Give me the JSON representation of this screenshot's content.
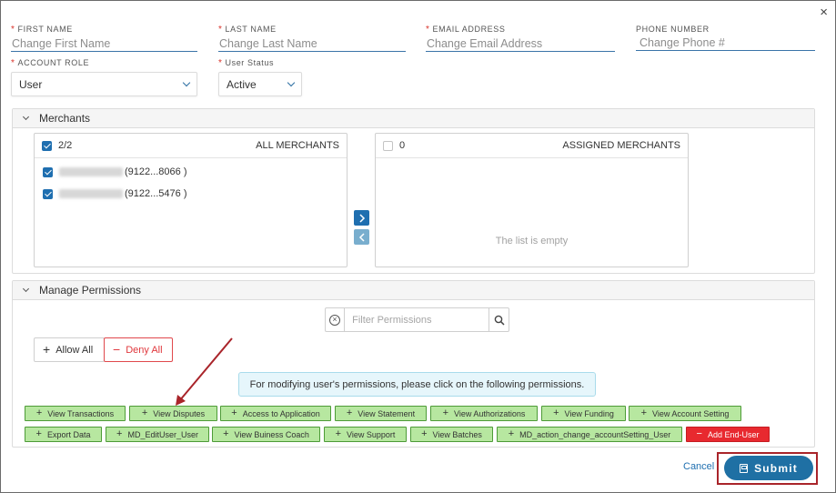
{
  "dialog": {
    "close_label": "×"
  },
  "fields": {
    "first_name": {
      "label": "FIRST NAME",
      "required_mark": "*",
      "placeholder": "Change First Name"
    },
    "last_name": {
      "label": "LAST NAME",
      "required_mark": "*",
      "placeholder": "Change Last Name"
    },
    "email": {
      "label": "EMAIL ADDRESS",
      "required_mark": "*",
      "placeholder": "Change Email Address"
    },
    "phone": {
      "label": "PHONE NUMBER",
      "placeholder": "Change Phone #"
    },
    "account_role": {
      "label": "ACCOUNT ROLE",
      "required_mark": "*",
      "value": "User"
    },
    "user_status": {
      "label": "User Status",
      "required_mark": "*",
      "value": "Active"
    }
  },
  "merchants": {
    "title": "Merchants",
    "all": {
      "count": "2/2",
      "title": "ALL MERCHANTS",
      "items": [
        {
          "suffix": "(9122...8066 )",
          "checked": true
        },
        {
          "suffix": "(9122...5476 )",
          "checked": true
        }
      ]
    },
    "assigned": {
      "count": "0",
      "title": "ASSIGNED MERCHANTS",
      "empty_text": "The list is empty"
    },
    "move_right_icon": "chevron-right-icon",
    "move_left_icon": "chevron-left-icon"
  },
  "permissions": {
    "title": "Manage Permissions",
    "filter_placeholder": "Filter Permissions",
    "allow_all": "Allow All",
    "deny_all": "Deny All",
    "info": "For modifying user's permissions, please click on the following permissions.",
    "row1": [
      "View Transactions",
      "View Disputes",
      "Access to Application",
      "View Statement",
      "View Authorizations",
      "View Funding",
      "View Account Setting"
    ],
    "row2": [
      "Export Data",
      "MD_EditUser_User",
      "View Buiness Coach",
      "View Support",
      "View Batches",
      "MD_action_change_accountSetting_User"
    ],
    "denied": "Add End-User"
  },
  "footer": {
    "cancel": "Cancel",
    "submit": "Submit"
  },
  "colors": {
    "primary": "#1f70a4",
    "allowed": "#b7e7a0",
    "denied": "#e8292f",
    "annotation": "#a9242a"
  }
}
